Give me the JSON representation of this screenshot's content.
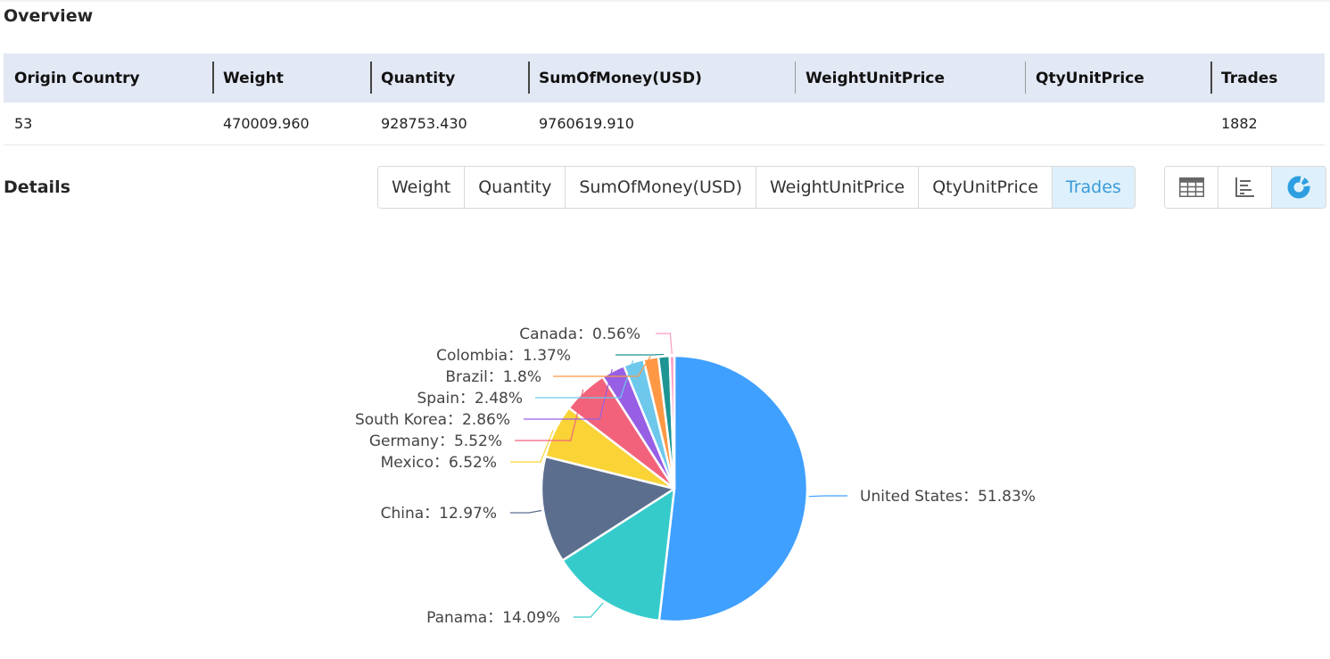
{
  "overview": {
    "title": "Overview",
    "columns": [
      "Origin Country",
      "Weight",
      "Quantity",
      "SumOfMoney(USD)",
      "WeightUnitPrice",
      "QtyUnitPrice",
      "Trades"
    ],
    "row": [
      "53",
      "470009.960",
      "928753.430",
      "9760619.910",
      "",
      "",
      "1882"
    ]
  },
  "details": {
    "title": "Details",
    "tabs": [
      {
        "label": "Weight",
        "active": false
      },
      {
        "label": "Quantity",
        "active": false
      },
      {
        "label": "SumOfMoney(USD)",
        "active": false
      },
      {
        "label": "WeightUnitPrice",
        "active": false
      },
      {
        "label": "QtyUnitPrice",
        "active": false
      },
      {
        "label": "Trades",
        "active": true
      }
    ],
    "view_buttons": [
      {
        "icon": "table-icon",
        "active": false
      },
      {
        "icon": "bar-chart-icon",
        "active": false
      },
      {
        "icon": "pie-chart-icon",
        "active": true
      }
    ],
    "accent_color": "#3a9ad9"
  },
  "chart_data": {
    "type": "pie",
    "title": "",
    "label_format": "{name}：{percent}%",
    "slices": [
      {
        "name": "United States",
        "percent": 51.83,
        "color": "#3fa0ff"
      },
      {
        "name": "Panama",
        "percent": 14.09,
        "color": "#36cbcb"
      },
      {
        "name": "China",
        "percent": 12.97,
        "color": "#5b6e8e"
      },
      {
        "name": "Mexico",
        "percent": 6.52,
        "color": "#fad337"
      },
      {
        "name": "Germany",
        "percent": 5.52,
        "color": "#f2637b"
      },
      {
        "name": "South Korea",
        "percent": 2.86,
        "color": "#975fe4"
      },
      {
        "name": "Spain",
        "percent": 2.48,
        "color": "#6dc8ec"
      },
      {
        "name": "Brazil",
        "percent": 1.8,
        "color": "#ff9845"
      },
      {
        "name": "Colombia",
        "percent": 1.37,
        "color": "#1e9493"
      },
      {
        "name": "Canada",
        "percent": 0.56,
        "color": "#ff99c3"
      }
    ]
  }
}
